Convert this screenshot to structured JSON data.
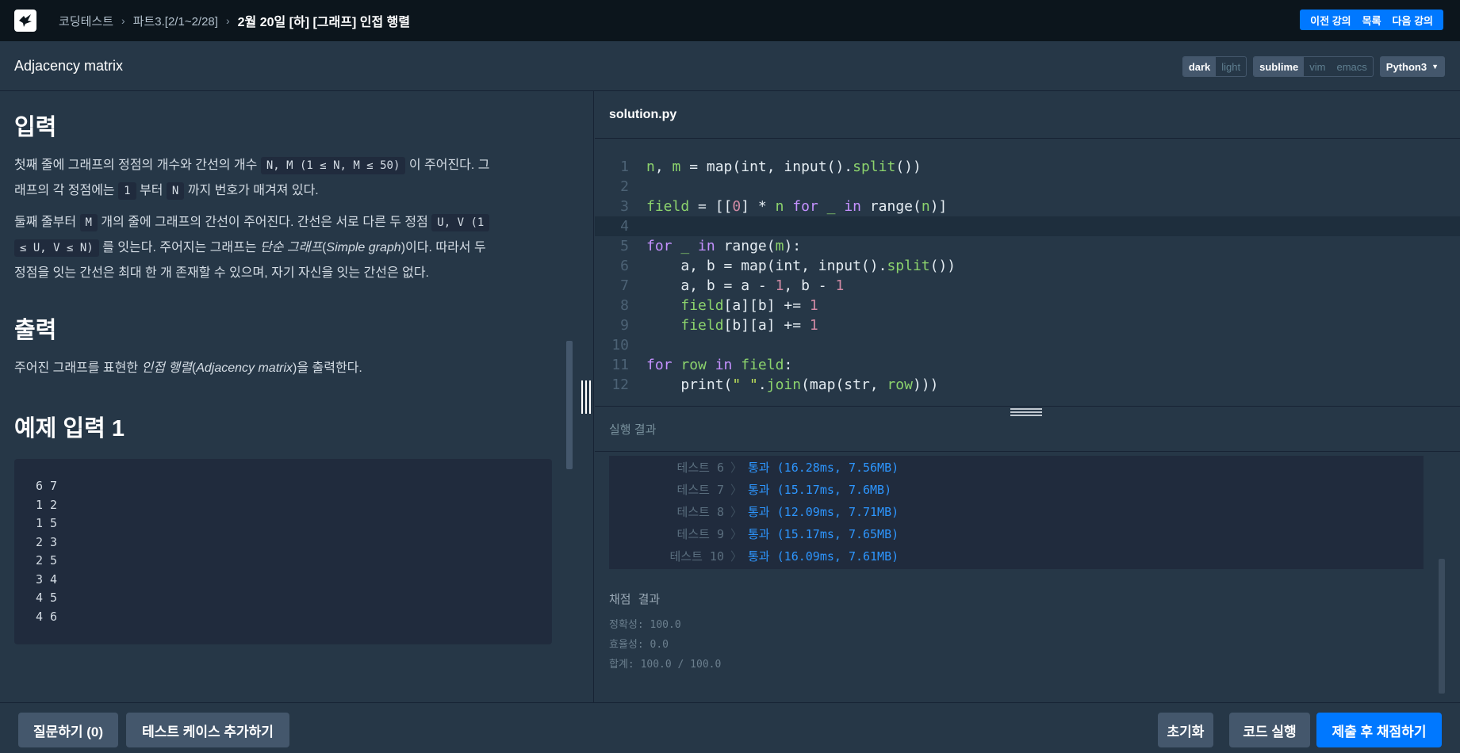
{
  "topbar": {
    "breadcrumb": [
      "코딩테스트",
      "파트3.[2/1~2/28]"
    ],
    "current": "2월 20일 [하] [그래프] 인접 행렬",
    "nav": {
      "prev": "이전 강의",
      "list": "목록",
      "next": "다음 강의"
    }
  },
  "header": {
    "title": "Adjacency matrix",
    "theme": {
      "dark": "dark",
      "light": "light"
    },
    "keymap": {
      "sublime": "sublime",
      "vim": "vim",
      "emacs": "emacs"
    },
    "language": "Python3"
  },
  "problem": {
    "input_heading": "입력",
    "input_p1": {
      "a": "첫째 줄에 그래프의 정점의 개수와 간선의 개수 ",
      "code1": "N, M (1 ≤ N, M ≤ 50)",
      "b": " 이 주어진다. 그",
      "c": "래프의 각 정점에는 ",
      "code2": "1",
      "d": " 부터 ",
      "code3": "N",
      "e": " 까지 번호가 매겨져 있다."
    },
    "input_p2": {
      "a": "둘째 줄부터 ",
      "code1": "M",
      "b": " 개의 줄에 그래프의 간선이 주어진다. 간선은 서로 다른 두 정점 ",
      "code2": "U, V (1",
      "code3": "≤ U, V ≤ N)",
      "c": " 를 잇는다. 주어지는 그래프는 ",
      "em1": "단순 그래프",
      "d": "(",
      "em2": "Simple graph",
      "e": ")이다. 따라서 두",
      "f": "정점을 잇는 간선은 최대 한 개 존재할 수 있으며, 자기 자신을 잇는 간선은 없다."
    },
    "output_heading": "출력",
    "output_p": {
      "a": "주어진 그래프를 표현한 ",
      "em1": "인접 행렬",
      "b": "(",
      "em2": "Adjacency matrix",
      "c": ")을 출력한다."
    },
    "example_heading": "예제 입력 1",
    "example_input": "6 7\n1 2\n1 5\n2 3\n2 5\n3 4\n4 5\n4 6"
  },
  "editor": {
    "filename": "solution.py",
    "line_numbers": [
      "1",
      "2",
      "3",
      "4",
      "5",
      "6",
      "7",
      "8",
      "9",
      "10",
      "11",
      "12"
    ]
  },
  "results": {
    "heading": "실행 결과",
    "tests": [
      {
        "name": "테스트 6",
        "result": "통과 (16.28ms, 7.56MB)"
      },
      {
        "name": "테스트 7",
        "result": "통과 (15.17ms, 7.6MB)"
      },
      {
        "name": "테스트 8",
        "result": "통과 (12.09ms, 7.71MB)"
      },
      {
        "name": "테스트 9",
        "result": "통과 (15.17ms, 7.65MB)"
      },
      {
        "name": "테스트 10",
        "result": "통과 (16.09ms, 7.61MB)"
      }
    ],
    "grade_title": "채점 결과",
    "accuracy": "정확성: 100.0",
    "efficiency": "효율성: 0.0",
    "total": "합계: 100.0 / 100.0"
  },
  "bottom": {
    "question": "질문하기 (0)",
    "add_test": "테스트 케이스 추가하기",
    "reset": "초기화",
    "run": "코드 실행",
    "submit": "제출 후 채점하기"
  }
}
